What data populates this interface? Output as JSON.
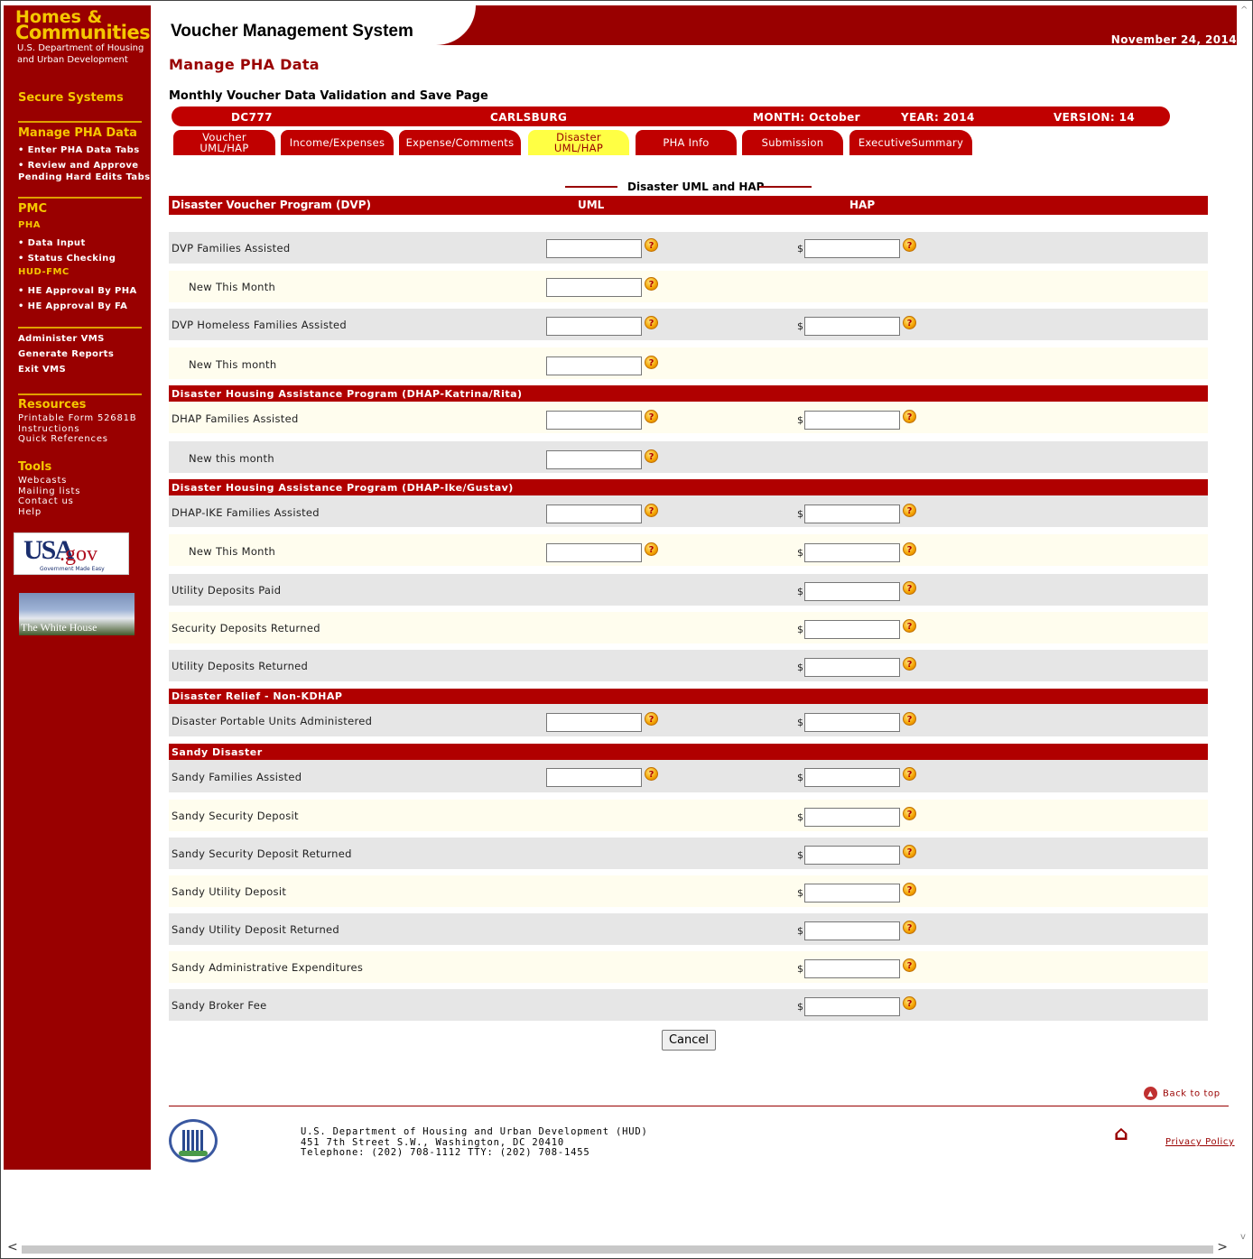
{
  "sidebar": {
    "logo_line1": "Homes &",
    "logo_line2": "Communities",
    "logo_line3": "U.S. Department of Housing",
    "logo_line4": "and Urban Development",
    "secure_systems": "Secure Systems",
    "manage_pha_data": "Manage PHA Data",
    "enter_pha_tabs": "•  Enter PHA Data Tabs",
    "review_approve_1": "•  Review and Approve",
    "review_approve_2": "Pending Hard Edits Tabs",
    "pmc": "PMC",
    "pha": "PHA",
    "data_input": "•  Data Input",
    "status_checking": "•  Status Checking",
    "hud_fmc": "HUD-FMC",
    "he_pha": "•  HE Approval By PHA",
    "he_fa": "•  HE Approval By FA",
    "administer_vms": "Administer VMS",
    "generate_reports": "Generate Reports",
    "exit_vms": "Exit VMS",
    "resources": "Resources",
    "printable_form": "Printable Form 52681B",
    "instructions": "Instructions",
    "quick_references": "Quick References",
    "tools": "Tools",
    "webcasts": "Webcasts",
    "mailing_lists": "Mailing lists",
    "contact_us": "Contact us",
    "help": "Help",
    "usa_gov_1": "USA",
    "usa_gov_2": ".gov",
    "usa_gov_sub": "Government Made Easy",
    "white_house": "The White House"
  },
  "header": {
    "title": "Voucher Management System",
    "date": "November 24, 2014"
  },
  "page": {
    "title": "Manage PHA Data",
    "subtitle": "Monthly Voucher Data Validation and Save Page"
  },
  "infobar": {
    "pha_code": "DC777",
    "pha_name": "CARLSBURG",
    "month": "MONTH: October",
    "year": "YEAR: 2014",
    "version": "VERSION: 14"
  },
  "tabs": [
    {
      "label1": "Voucher",
      "label2": "UML/HAP"
    },
    {
      "label1": "Income/Expenses",
      "label2": ""
    },
    {
      "label1": "Expense/Comments",
      "label2": ""
    },
    {
      "label1": "Disaster",
      "label2": "UML/HAP"
    },
    {
      "label1": "PHA Info",
      "label2": ""
    },
    {
      "label1": "Submission",
      "label2": ""
    },
    {
      "label1": "ExecutiveSummary",
      "label2": ""
    }
  ],
  "section_title": "Disaster UML and HAP",
  "table": {
    "header_label": "Disaster Voucher Program (DVP)",
    "col_uml": "UML",
    "col_hap": "HAP",
    "dollar": "$",
    "help_glyph": "?",
    "rows": [
      {
        "label": "DVP Families Assisted"
      },
      {
        "label": "New This Month"
      },
      {
        "label": "DVP Homeless Families Assisted"
      },
      {
        "label": "New This month"
      },
      {
        "label": "Disaster Housing Assistance Program (DHAP-Katrina/Rita)"
      },
      {
        "label": "DHAP Families Assisted"
      },
      {
        "label": "New this month"
      },
      {
        "label": "Disaster Housing Assistance Program (DHAP-Ike/Gustav)"
      },
      {
        "label": "DHAP-IKE Families Assisted"
      },
      {
        "label": "New This Month"
      },
      {
        "label": "Utility Deposits Paid"
      },
      {
        "label": "Security Deposits Returned"
      },
      {
        "label": "Utility Deposits Returned"
      },
      {
        "label": "Disaster Relief - Non-KDHAP"
      },
      {
        "label": "Disaster Portable Units Administered"
      },
      {
        "label": "Sandy Disaster"
      },
      {
        "label": "Sandy Families Assisted"
      },
      {
        "label": "Sandy Security Deposit"
      },
      {
        "label": "Sandy Security Deposit Returned"
      },
      {
        "label": "Sandy Utility Deposit"
      },
      {
        "label": "Sandy Utility Deposit Returned"
      },
      {
        "label": "Sandy Administrative Expenditures"
      },
      {
        "label": "Sandy Broker Fee"
      }
    ]
  },
  "cancel_label": "Cancel",
  "footer": {
    "back_to_top": "Back to top",
    "address1": "U.S. Department of Housing and Urban Development (HUD)",
    "address2": "451 7th Street S.W., Washington, DC 20410",
    "address3": "Telephone: (202) 708-1112  TTY: (202) 708-1455",
    "privacy": "Privacy Policy"
  }
}
